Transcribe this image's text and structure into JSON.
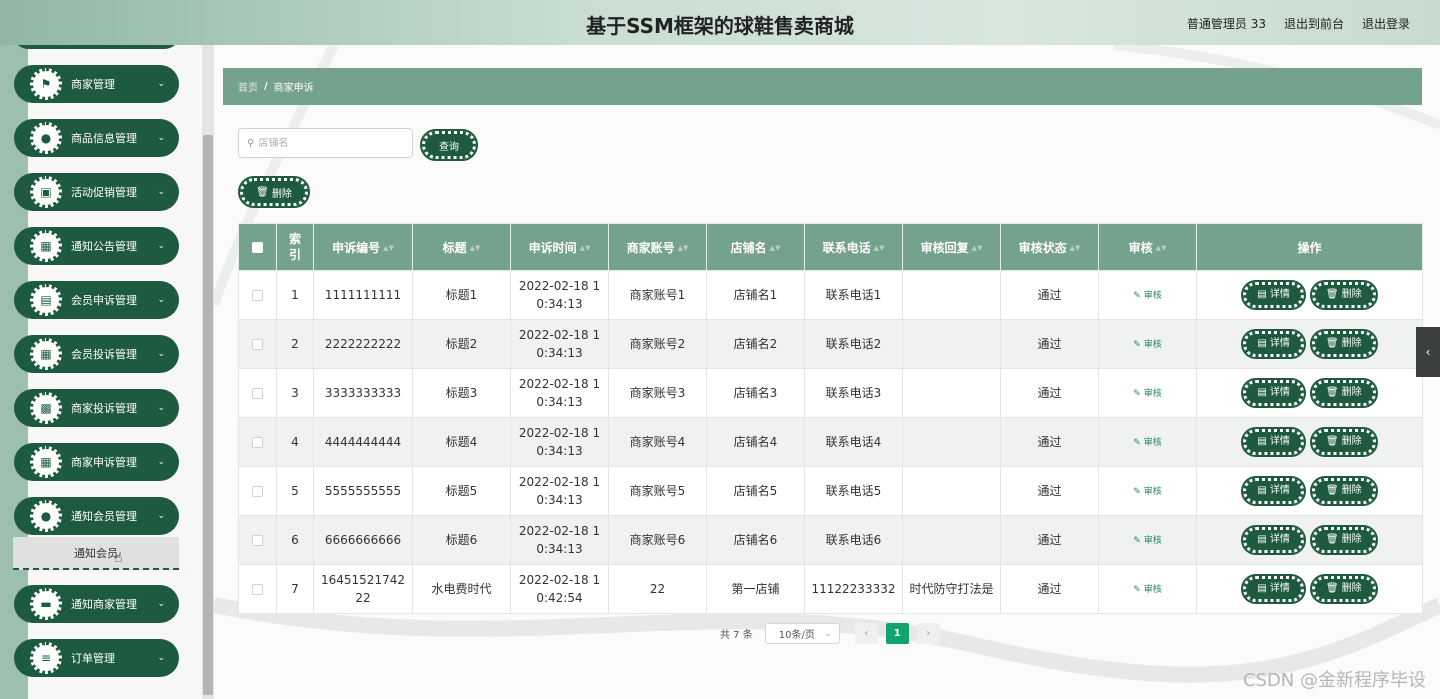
{
  "app": {
    "title": "基于SSM框架的球鞋售卖商城",
    "user_label": "普通管理员 33",
    "front_link": "退出到前台",
    "logout_link": "退出登录"
  },
  "sidebar": {
    "items": [
      {
        "label": "商家管理",
        "icon": "flag-icon",
        "glyph": "⚑"
      },
      {
        "label": "商品信息管理",
        "icon": "user-icon",
        "glyph": "●"
      },
      {
        "label": "活动促销管理",
        "icon": "briefcase-icon",
        "glyph": "▣"
      },
      {
        "label": "通知公告管理",
        "icon": "grid-icon",
        "glyph": "▦"
      },
      {
        "label": "会员申诉管理",
        "icon": "document-icon",
        "glyph": "▤"
      },
      {
        "label": "会员投诉管理",
        "icon": "grid-icon",
        "glyph": "▦"
      },
      {
        "label": "商家投诉管理",
        "icon": "table-icon",
        "glyph": "▩"
      },
      {
        "label": "商家申诉管理",
        "icon": "grid-icon",
        "glyph": "▦"
      },
      {
        "label": "通知会员管理",
        "icon": "user-icon",
        "glyph": "●"
      },
      {
        "label": "通知商家管理",
        "icon": "monitor-icon",
        "glyph": "▬"
      },
      {
        "label": "订单管理",
        "icon": "list-icon",
        "glyph": "≡"
      }
    ],
    "submenu_label": "通知会员"
  },
  "breadcrumb": {
    "home": "首页",
    "separator": "/",
    "current": "商家申诉"
  },
  "search": {
    "placeholder": "店铺名",
    "value": "",
    "query_button": "查询"
  },
  "toolbar": {
    "delete_button": "删除"
  },
  "table": {
    "columns": [
      "索引",
      "申诉编号",
      "标题",
      "申诉时间",
      "商家账号",
      "店铺名",
      "联系电话",
      "审核回复",
      "审核状态",
      "审核",
      "操作"
    ],
    "audit_link": "审核",
    "detail_button": "详情",
    "delete_button": "删除",
    "rows": [
      {
        "index": "1",
        "no": "1111111111",
        "title": "标题1",
        "time": "2022-02-18 10:34:13",
        "account": "商家账号1",
        "shop": "店铺名1",
        "phone": "联系电话1",
        "reply": "",
        "status": "通过"
      },
      {
        "index": "2",
        "no": "2222222222",
        "title": "标题2",
        "time": "2022-02-18 10:34:13",
        "account": "商家账号2",
        "shop": "店铺名2",
        "phone": "联系电话2",
        "reply": "",
        "status": "通过"
      },
      {
        "index": "3",
        "no": "3333333333",
        "title": "标题3",
        "time": "2022-02-18 10:34:13",
        "account": "商家账号3",
        "shop": "店铺名3",
        "phone": "联系电话3",
        "reply": "",
        "status": "通过"
      },
      {
        "index": "4",
        "no": "4444444444",
        "title": "标题4",
        "time": "2022-02-18 10:34:13",
        "account": "商家账号4",
        "shop": "店铺名4",
        "phone": "联系电话4",
        "reply": "",
        "status": "通过"
      },
      {
        "index": "5",
        "no": "5555555555",
        "title": "标题5",
        "time": "2022-02-18 10:34:13",
        "account": "商家账号5",
        "shop": "店铺名5",
        "phone": "联系电话5",
        "reply": "",
        "status": "通过"
      },
      {
        "index": "6",
        "no": "6666666666",
        "title": "标题6",
        "time": "2022-02-18 10:34:13",
        "account": "商家账号6",
        "shop": "店铺名6",
        "phone": "联系电话6",
        "reply": "",
        "status": "通过"
      },
      {
        "index": "7",
        "no": "1645152174222",
        "title": "水电费时代",
        "time": "2022-02-18 10:42:54",
        "account": "22",
        "shop": "第一店铺",
        "phone": "11122233332",
        "reply": "时代防守打法是",
        "status": "通过"
      }
    ]
  },
  "pagination": {
    "total": "共 7 条",
    "page_size": "10条/页",
    "current_page": "1",
    "prev": "‹",
    "next": "›"
  },
  "watermark": "CSDN @金新程序毕设",
  "colors": {
    "primary": "#1d5a3f",
    "header_green": "#74a28c",
    "active_page": "#12a36e"
  }
}
